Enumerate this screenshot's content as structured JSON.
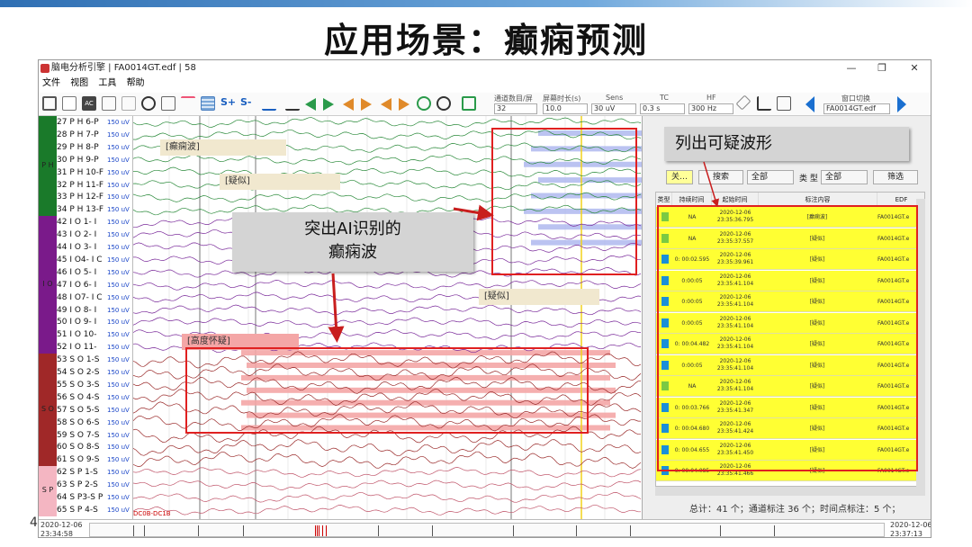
{
  "slide": {
    "title": "应用场景：癫痫预测",
    "page_number": "4"
  },
  "window": {
    "title": "脑电分析引擎 | FA0014GT.edf | 58",
    "controls": [
      "—",
      "❐",
      "✕"
    ],
    "menu": [
      "文件",
      "视图",
      "工具",
      "帮助"
    ]
  },
  "toolbar": {
    "labels": {
      "channels": "通道数目/屏",
      "duration": "屏幕时长(s)",
      "sens": "Sens",
      "tc": "TC",
      "hf": "HF",
      "window_switch": "窗口切换"
    },
    "values": {
      "channels": "32",
      "duration": "10.0",
      "sens": "30 uV",
      "tc": "0.3 s",
      "hf": "300 Hz",
      "window_switch": "FA0014GT.edf"
    },
    "text_buttons": [
      "S+",
      "S-"
    ]
  },
  "channels": {
    "groups": [
      {
        "name": "P H",
        "color": "#1a7a2a"
      },
      {
        "name": "I O",
        "color": "#7a1a8a"
      },
      {
        "name": "S O",
        "color": "#a02828"
      },
      {
        "name": "S P",
        "color": "#f4b6c2"
      }
    ],
    "unit": "150 uV",
    "rows": [
      "27 P H 6-P",
      "28 P H 7-P",
      "29 P H 8-P",
      "30 P H 9-P",
      "31 P H 10-F",
      "32 P H 11-F",
      "33 P H 12-F",
      "34 P H 13-F",
      "42 I O 1- I",
      "43 I O 2- I",
      "44 I O 3- I",
      "45 I O4- I C",
      "46 I O 5- I",
      "47 I O 6- I",
      "48 I O7- I C",
      "49 I O 8- I",
      "50 I O 9- I",
      "51 I O 10-",
      "52 I O 11-",
      "53 S O 1-S",
      "54 S O 2-S",
      "55 S O 3-S",
      "56 S O 4-S",
      "57 S O 5-S",
      "58 S O 6-S",
      "59 S O 7-S",
      "60 S O 8-S",
      "61 S O 9-S",
      "62 S P 1-S",
      "63 S P 2-S",
      "64 S P3-S P",
      "65 S P 4-S"
    ],
    "group_labels_overlay": [
      "P H",
      "I O",
      "S O",
      "S P"
    ]
  },
  "annotations": [
    {
      "label": "[癫痫波]",
      "color": "#f1e8cf"
    },
    {
      "label": "[疑似]",
      "color": "#f1e8cf"
    },
    {
      "label": "[疑似]",
      "color": "#f1e8cf"
    },
    {
      "label": "[高度怀疑]",
      "color": "#f4a6a6"
    }
  ],
  "montage_label": "DC0B-DC1B",
  "right_panel": {
    "search_value": "关…",
    "search_button": "搜索",
    "filter_all_1": "全部",
    "type_label": "类 型",
    "filter_all_2": "全部",
    "filter_button": "筛选",
    "columns": [
      "类型",
      "持续时间",
      "起始时间",
      "标注内容",
      "EDF"
    ],
    "rows": [
      {
        "type_color": "#7ac943",
        "duration": "NA",
        "start": "2020-12-06 23:35:36.795",
        "content": "[癫痫波]",
        "edf": "FA0014GT.e"
      },
      {
        "type_color": "#7ac943",
        "duration": "NA",
        "start": "2020-12-06 23:35:37.557",
        "content": "[疑似]",
        "edf": "FA0014GT.e"
      },
      {
        "type_color": "#1a8fd8",
        "duration": "0: 00:02.595",
        "start": "2020-12-06 23:35:39.961",
        "content": "[疑似]",
        "edf": "FA0014GT.e"
      },
      {
        "type_color": "#1a8fd8",
        "duration": "0:00:05",
        "start": "2020-12-06 23:35:41.104",
        "content": "[疑似]",
        "edf": "FA0014GT.e"
      },
      {
        "type_color": "#1a8fd8",
        "duration": "0:00:05",
        "start": "2020-12-06 23:35:41.104",
        "content": "[疑似]",
        "edf": "FA0014GT.e"
      },
      {
        "type_color": "#1a8fd8",
        "duration": "0:00:05",
        "start": "2020-12-06 23:35:41.104",
        "content": "[疑似]",
        "edf": "FA0014GT.e"
      },
      {
        "type_color": "#1a8fd8",
        "duration": "0: 00:04.482",
        "start": "2020-12-06 23:35:41.104",
        "content": "[疑似]",
        "edf": "FA0014GT.e"
      },
      {
        "type_color": "#1a8fd8",
        "duration": "0:00:05",
        "start": "2020-12-06 23:35:41.104",
        "content": "[疑似]",
        "edf": "FA0014GT.e"
      },
      {
        "type_color": "#7ac943",
        "duration": "NA",
        "start": "2020-12-06 23:35:41.104",
        "content": "[疑似]",
        "edf": "FA0014GT.e"
      },
      {
        "type_color": "#1a8fd8",
        "duration": "0: 00:03.766",
        "start": "2020-12-06 23:35:41.347",
        "content": "[疑似]",
        "edf": "FA0014GT.e"
      },
      {
        "type_color": "#1a8fd8",
        "duration": "0: 00:04.680",
        "start": "2020-12-06 23:35:41.424",
        "content": "[疑似]",
        "edf": "FA0014GT.e"
      },
      {
        "type_color": "#1a8fd8",
        "duration": "0: 00:04.655",
        "start": "2020-12-06 23:35:41.450",
        "content": "[疑似]",
        "edf": "FA0014GT.e"
      },
      {
        "type_color": "#1a8fd8",
        "duration": "0: 00:04.085",
        "start": "2020-12-06 23:35:41.466",
        "content": "[疑似]",
        "edf": "FA0014GT.e"
      }
    ],
    "summary": "总计：41 个；通道标注 36 个；时间点标注：5 个；"
  },
  "timeline": {
    "start_date": "2020-12-06",
    "start_time": "23:34:58",
    "end_date": "2020-12-06",
    "end_time": "23:37:13"
  },
  "callouts": {
    "left": "突出AI识别的\n癫痫波",
    "right": "列出可疑波形"
  },
  "colors": {
    "accent_red": "#e02020",
    "highlight_yellow": "#ffff33",
    "seizure_overlay": "#f4a6a6",
    "suspect_overlay": "#aab4ee"
  }
}
